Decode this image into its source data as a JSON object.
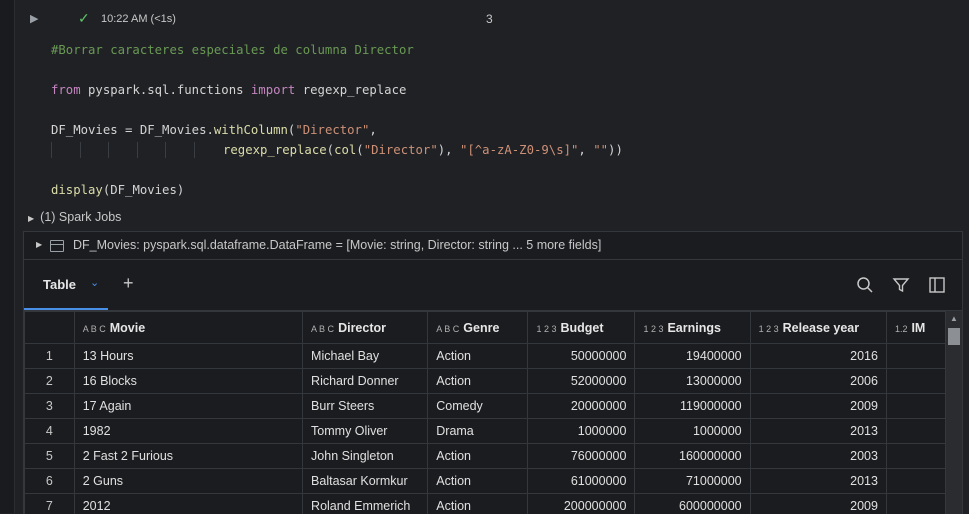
{
  "cell": {
    "status_time": "10:22 AM (<1s)",
    "cell_number": "3"
  },
  "code": {
    "line1": "#Borrar caracteres especiales de columna Director",
    "line3_kw1": "from",
    "line3_mod": " pyspark.sql.functions ",
    "line3_kw2": "import",
    "line3_name": " regexp_replace",
    "line5_a": "DF_Movies = DF_Movies.",
    "line5_fn": "withColumn",
    "line5_p": "(",
    "line5_str": "\"Director\"",
    "line5_c": ",",
    "line6_fn": "regexp_replace",
    "line6_p1": "(",
    "line6_fn2": "col",
    "line6_p2": "(",
    "line6_s1": "\"Director\"",
    "line6_p3": "), ",
    "line6_s2": "\"[^a-zA-Z0-9\\s]\"",
    "line6_p4": ", ",
    "line6_s3": "\"\"",
    "line6_p5": "))",
    "line8_fn": "display",
    "line8_arg": "(DF_Movies)"
  },
  "spark_jobs": "(1) Spark Jobs",
  "schema_text": "DF_Movies:  pyspark.sql.dataframe.DataFrame = [Movie: string, Director: string ... 5 more fields]",
  "tabs": {
    "table_label": "Table"
  },
  "table": {
    "columns": [
      {
        "type": "A B C",
        "name": "Movie"
      },
      {
        "type": "A B C",
        "name": "Director"
      },
      {
        "type": "A B C",
        "name": "Genre"
      },
      {
        "type": "1 2 3",
        "name": "Budget"
      },
      {
        "type": "1 2 3",
        "name": "Earnings"
      },
      {
        "type": "1 2 3",
        "name": "Release year"
      },
      {
        "type": "1.2",
        "name": "IM"
      }
    ],
    "rows": [
      {
        "idx": "1",
        "movie": "13 Hours",
        "director": "Michael Bay",
        "genre": "Action",
        "budget": "50000000",
        "earnings": "19400000",
        "year": "2016"
      },
      {
        "idx": "2",
        "movie": "16 Blocks",
        "director": "Richard Donner",
        "genre": "Action",
        "budget": "52000000",
        "earnings": "13000000",
        "year": "2006"
      },
      {
        "idx": "3",
        "movie": "17 Again",
        "director": "Burr Steers",
        "genre": "Comedy",
        "budget": "20000000",
        "earnings": "119000000",
        "year": "2009"
      },
      {
        "idx": "4",
        "movie": "1982",
        "director": "Tommy Oliver",
        "genre": "Drama",
        "budget": "1000000",
        "earnings": "1000000",
        "year": "2013"
      },
      {
        "idx": "5",
        "movie": "2 Fast 2 Furious",
        "director": "John Singleton",
        "genre": "Action",
        "budget": "76000000",
        "earnings": "160000000",
        "year": "2003"
      },
      {
        "idx": "6",
        "movie": "2 Guns",
        "director": "Baltasar Kormkur",
        "genre": "Action",
        "budget": "61000000",
        "earnings": "71000000",
        "year": "2013"
      },
      {
        "idx": "7",
        "movie": "2012",
        "director": "Roland Emmerich",
        "genre": "Action",
        "budget": "200000000",
        "earnings": "600000000",
        "year": "2009"
      }
    ]
  },
  "colors": {
    "accent": "#4a8fe7",
    "success": "#5cc46a"
  }
}
